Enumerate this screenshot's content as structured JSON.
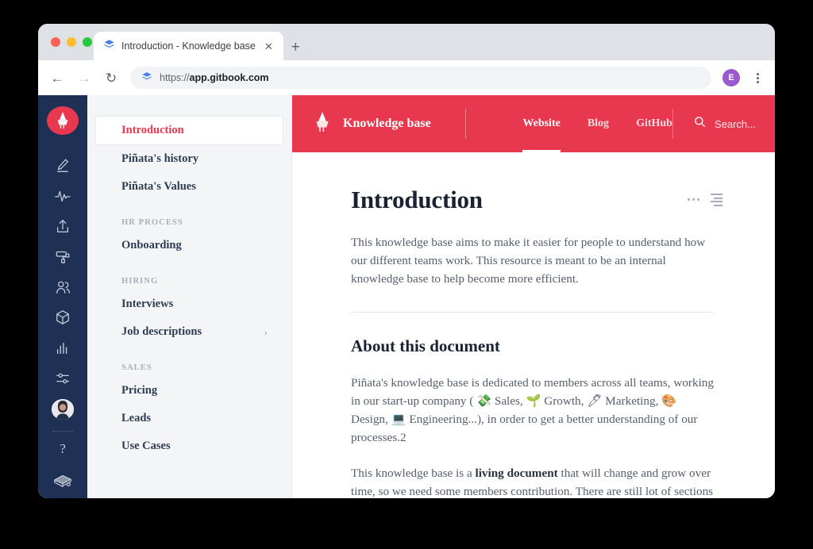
{
  "browser": {
    "tab": {
      "title": "Introduction - Knowledge base",
      "favicon": "gitbook-icon",
      "close_label": "✕"
    },
    "new_tab_label": "+",
    "back_label": "←",
    "forward_label": "→",
    "reload_label": "↻",
    "url_prefix": "https://",
    "url_domain": "app.gitbook.com",
    "profile_initial": "E"
  },
  "rail": {
    "logo_name": "pinata-logo",
    "items": [
      {
        "icon": "pencil-edit-icon",
        "name": "rail-item-edit"
      },
      {
        "icon": "activity-pulse-icon",
        "name": "rail-item-activity"
      },
      {
        "icon": "upload-icon",
        "name": "rail-item-publish"
      },
      {
        "icon": "paint-roller-icon",
        "name": "rail-item-customize"
      },
      {
        "icon": "users-icon",
        "name": "rail-item-members"
      },
      {
        "icon": "cube-icon",
        "name": "rail-item-integrations"
      },
      {
        "icon": "bar-chart-icon",
        "name": "rail-item-insights"
      },
      {
        "icon": "sliders-icon",
        "name": "rail-item-settings"
      }
    ],
    "avatar_name": "user-avatar",
    "help_label": "?",
    "bottom_icon": "books-icon"
  },
  "docnav": {
    "groups": [
      {
        "section": null,
        "items": [
          {
            "label": "Introduction",
            "active": true,
            "chevron": false
          },
          {
            "label": "Piñata's history",
            "active": false,
            "chevron": false
          },
          {
            "label": "Piñata's Values",
            "active": false,
            "chevron": false
          }
        ]
      },
      {
        "section": "HR PROCESS",
        "items": [
          {
            "label": "Onboarding",
            "active": false,
            "chevron": false
          }
        ]
      },
      {
        "section": "HIRING",
        "items": [
          {
            "label": "Interviews",
            "active": false,
            "chevron": false
          },
          {
            "label": "Job descriptions",
            "active": false,
            "chevron": true
          }
        ]
      },
      {
        "section": "SALES",
        "items": [
          {
            "label": "Pricing",
            "active": false,
            "chevron": false
          },
          {
            "label": "Leads",
            "active": false,
            "chevron": false
          },
          {
            "label": "Use Cases",
            "active": false,
            "chevron": false
          }
        ]
      }
    ],
    "chevron_glyph": "›"
  },
  "site_header": {
    "brand": "Knowledge base",
    "brand_logo": "pinata-logo",
    "nav": [
      {
        "label": "Website",
        "active": true
      },
      {
        "label": "Blog",
        "active": false
      },
      {
        "label": "GitHub",
        "active": false
      }
    ],
    "search_label": "Search...",
    "search_icon": "search-icon",
    "accent_color": "#e8384f"
  },
  "article": {
    "title": "Introduction",
    "intro": "This knowledge base aims to make it easier for people to understand how our different teams work. This resource is meant to be an internal knowledge base to help become more efficient.",
    "heading2": "About this document",
    "para_about_1": "Piñata's knowledge base is dedicated to members across all teams, working in our start-up company ( 💸 Sales, 🌱 Growth, 🖊 Marketing, 🎨 Design, 💻 Engineering...), in order to get a better understanding of our processes.2",
    "para_living_prefix": "This knowledge base is a ",
    "para_living_bold": "living document",
    "para_living_suffix": " that will change and grow over time, so we need some members contribution. There are still lot of sections to document, if you see anything that is missing or could be improved, feel free to edit it 😊",
    "more_options_icon": "more-options-icon",
    "toc_icon": "table-of-contents-icon"
  }
}
